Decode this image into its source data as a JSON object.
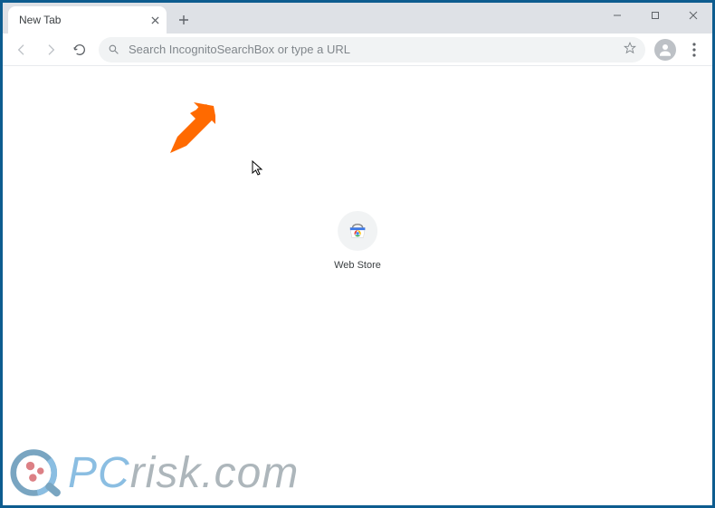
{
  "tab": {
    "title": "New Tab"
  },
  "omnibox": {
    "placeholder": "Search IncognitoSearchBox or type a URL"
  },
  "shortcut": {
    "label": "Web Store"
  },
  "watermark": {
    "prefix": "PC",
    "suffix": "risk.com"
  }
}
